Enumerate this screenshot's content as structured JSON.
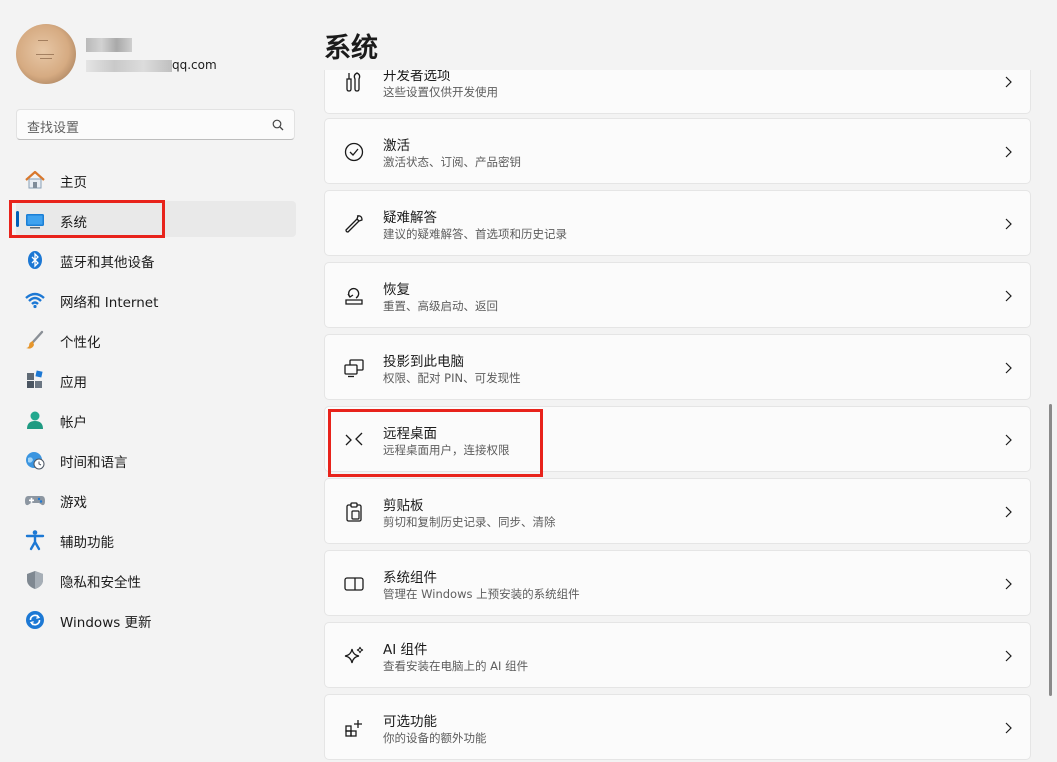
{
  "profile": {
    "email_suffix": "qq.com"
  },
  "search": {
    "placeholder": "查找设置"
  },
  "page": {
    "title": "系统"
  },
  "sidebar": {
    "items": [
      {
        "label": "主页",
        "icon": "home-icon"
      },
      {
        "label": "系统",
        "icon": "monitor-icon",
        "selected": true
      },
      {
        "label": "蓝牙和其他设备",
        "icon": "bluetooth-icon"
      },
      {
        "label": "网络和 Internet",
        "icon": "wifi-icon"
      },
      {
        "label": "个性化",
        "icon": "brush-icon"
      },
      {
        "label": "应用",
        "icon": "apps-icon"
      },
      {
        "label": "帐户",
        "icon": "account-icon"
      },
      {
        "label": "时间和语言",
        "icon": "globe-clock-icon"
      },
      {
        "label": "游戏",
        "icon": "gamepad-icon"
      },
      {
        "label": "辅助功能",
        "icon": "accessibility-icon"
      },
      {
        "label": "隐私和安全性",
        "icon": "shield-icon"
      },
      {
        "label": "Windows 更新",
        "icon": "update-icon"
      }
    ]
  },
  "settings": [
    {
      "title": "开发者选项",
      "subtitle": "这些设置仅供开发使用",
      "icon": "developer-icon"
    },
    {
      "title": "激活",
      "subtitle": "激活状态、订阅、产品密钥",
      "icon": "check-circle-icon"
    },
    {
      "title": "疑难解答",
      "subtitle": "建议的疑难解答、首选项和历史记录",
      "icon": "wrench-icon"
    },
    {
      "title": "恢复",
      "subtitle": "重置、高级启动、返回",
      "icon": "recovery-icon"
    },
    {
      "title": "投影到此电脑",
      "subtitle": "权限、配对 PIN、可发现性",
      "icon": "project-icon"
    },
    {
      "title": "远程桌面",
      "subtitle": "远程桌面用户，连接权限",
      "icon": "remote-desktop-icon"
    },
    {
      "title": "剪贴板",
      "subtitle": "剪切和复制历史记录、同步、清除",
      "icon": "clipboard-icon"
    },
    {
      "title": "系统组件",
      "subtitle": "管理在 Windows 上预安装的系统组件",
      "icon": "components-icon"
    },
    {
      "title": "AI 组件",
      "subtitle": "查看安装在电脑上的 AI 组件",
      "icon": "sparkle-icon"
    },
    {
      "title": "可选功能",
      "subtitle": "你的设备的额外功能",
      "icon": "optional-features-icon"
    }
  ],
  "colors": {
    "accent": "#005fb8",
    "highlight_border": "#e8231b",
    "background": "#f3f3f3",
    "card": "#fbfbfb"
  }
}
